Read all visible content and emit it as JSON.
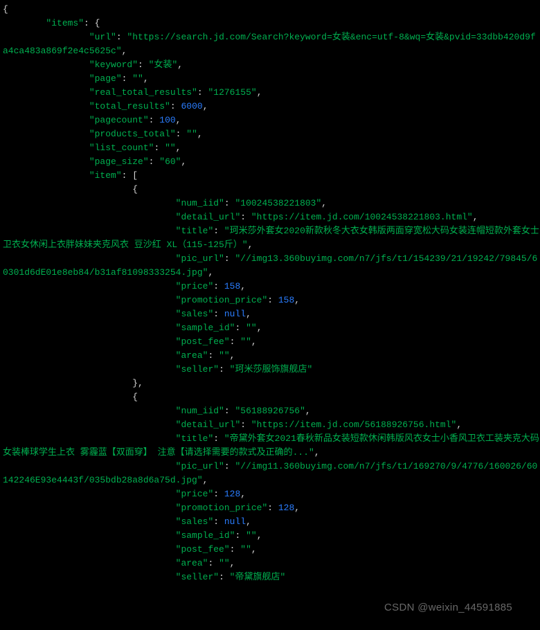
{
  "watermark": "CSDN @weixin_44591885",
  "json_root": {
    "items": {
      "url": "https://search.jd.com/Search?keyword=女装&enc=utf-8&wq=女装&pvid=33dbb420d9fa4ca483a869f2e4c5625c",
      "keyword": "女装",
      "page": "",
      "real_total_results": "1276155",
      "total_results": 6000,
      "pagecount": 100,
      "products_total": "",
      "list_count": "",
      "page_size": "60",
      "item": [
        {
          "num_iid": "10024538221803",
          "detail_url": "https://item.jd.com/10024538221803.html",
          "title": "珂米莎外套女2020新款秋冬大衣女韩版两面穿宽松大码女装连帽短款外套女士卫衣女休闲上衣胖妹妹夹克风衣 豆沙红 XL（115-125斤）",
          "pic_url": "//img13.360buyimg.com/n7/jfs/t1/154239/21/19242/79845/60301d6dE01e8eb84/b31af81098333254.jpg",
          "price": 158,
          "promotion_price": 158,
          "sales": null,
          "sample_id": "",
          "post_fee": "",
          "area": "",
          "seller": "珂米莎服饰旗舰店"
        },
        {
          "num_iid": "56188926756",
          "detail_url": "https://item.jd.com/56188926756.html",
          "title": "帝黛外套女2021春秋新品女装短款休闲韩版风衣女士小香风卫衣工装夹克大码女装棒球学生上衣 雾霾蓝【双面穿】 注意【请选择需要的款式及正确的...",
          "pic_url": "//img11.360buyimg.com/n7/jfs/t1/169270/9/4776/160026/60142246E93e4443f/035bdb28a8d6a75d.jpg",
          "price": 128,
          "promotion_price": 128,
          "sales": null,
          "sample_id": "",
          "post_fee": "",
          "area": "",
          "seller": "帝黛旗舰店"
        }
      ]
    }
  }
}
